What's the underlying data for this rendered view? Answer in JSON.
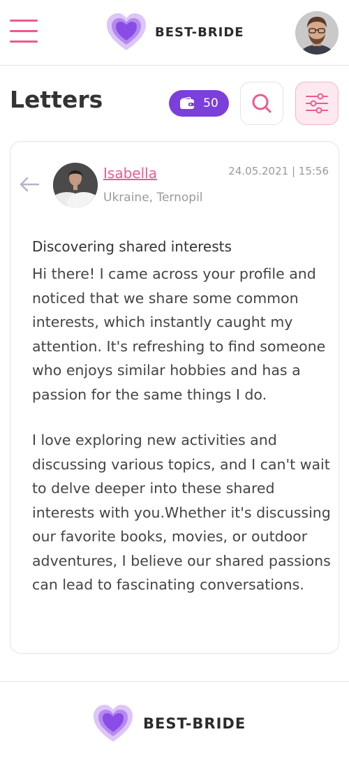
{
  "header": {
    "brand": "BEST-BRIDE"
  },
  "page": {
    "title": "Letters",
    "credits": "50"
  },
  "letter": {
    "sender_name": "Isabella",
    "sender_location": "Ukraine, Ternopil",
    "date": "24.05.2021 | 15:56",
    "subject": "Discovering shared interests",
    "paragraphs": [
      "Hi there! I came across your profile and noticed that we share some common interests, which instantly caught my attention. It's refreshing to find someone who enjoys similar hobbies and has a passion for the same things I do.",
      "I love exploring new activities and discussing various topics, and I can't wait to delve deeper into these shared interests with you.Whether it's discussing our favorite books, movies, or outdoor adventures, I believe our shared passions can lead to fascinating conversations."
    ]
  },
  "footer": {
    "brand": "BEST-BRIDE"
  },
  "colors": {
    "accent_pink": "#ec5a91",
    "accent_purple": "#7b3fdc",
    "heart_purple": "#8a4ce6",
    "heart_light": "#c9a6f3"
  },
  "icons": {
    "menu": "hamburger-icon",
    "logo": "heart-logo-icon",
    "wallet": "wallet-icon",
    "search": "search-icon",
    "filter": "sliders-icon",
    "back": "arrow-left-icon"
  }
}
